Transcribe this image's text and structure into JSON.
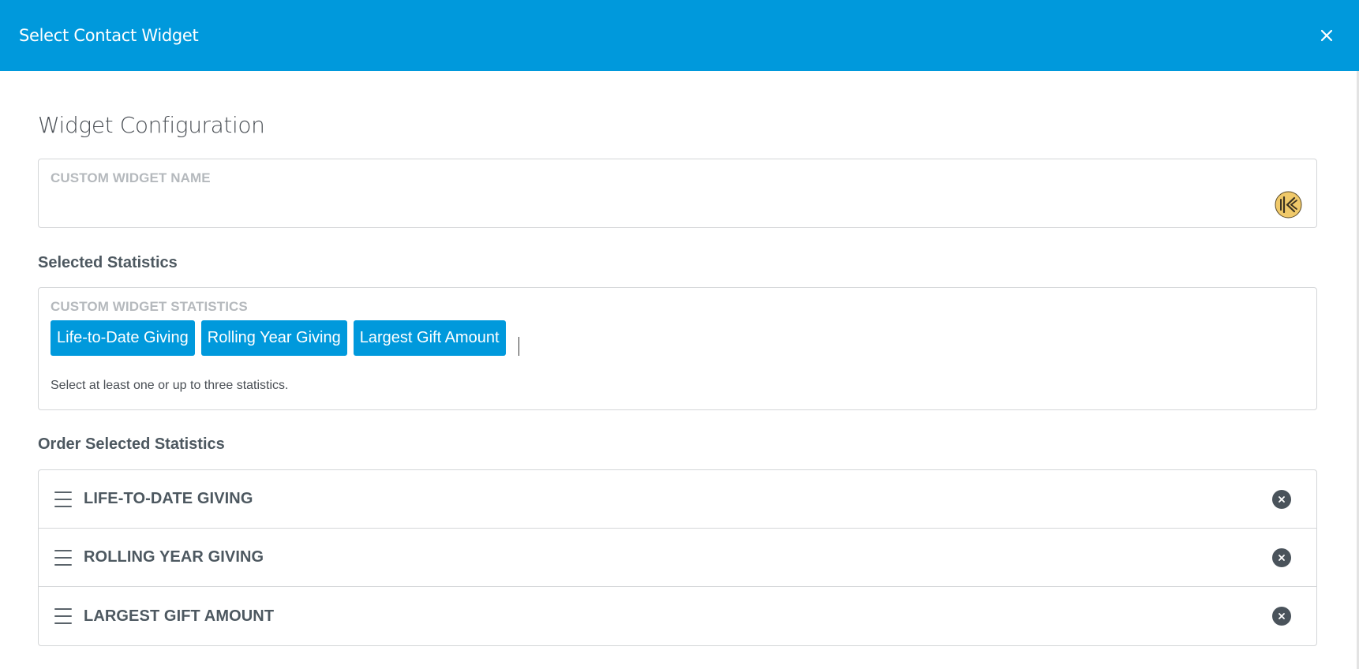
{
  "header": {
    "title": "Select Contact Widget",
    "close_icon": "close-icon"
  },
  "colors": {
    "brand": "#0099dc",
    "heading": "#4d5860",
    "label_muted": "#b5b9bd",
    "border": "#d4d6d8"
  },
  "config": {
    "title": "Widget Configuration",
    "name_field": {
      "label": "CUSTOM WIDGET NAME",
      "value": "",
      "placeholder": "",
      "icon": "keeper-icon"
    }
  },
  "selected_statistics": {
    "heading": "Selected Statistics",
    "field_label": "CUSTOM WIDGET STATISTICS",
    "chips": [
      "Life-to-Date Giving",
      "Rolling Year Giving",
      "Largest Gift Amount"
    ],
    "help_text": "Select at least one or up to three statistics."
  },
  "order": {
    "heading": "Order Selected Statistics",
    "items": [
      {
        "label": "LIFE-TO-DATE GIVING",
        "handle_icon": "drag-handle-icon",
        "remove_icon": "remove-circle-icon"
      },
      {
        "label": "ROLLING YEAR GIVING",
        "handle_icon": "drag-handle-icon",
        "remove_icon": "remove-circle-icon"
      },
      {
        "label": "LARGEST GIFT AMOUNT",
        "handle_icon": "drag-handle-icon",
        "remove_icon": "remove-circle-icon"
      }
    ]
  }
}
